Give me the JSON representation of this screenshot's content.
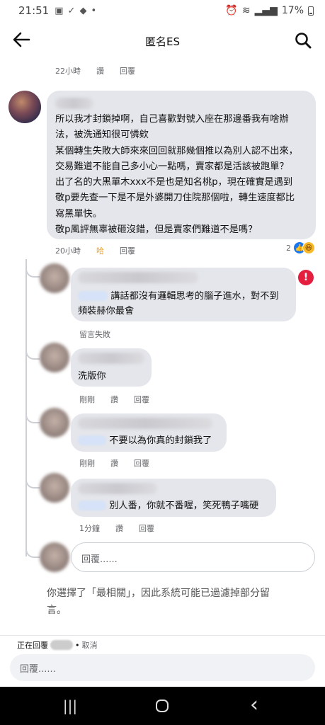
{
  "status_bar": {
    "time": "21:51",
    "dot": "•",
    "battery_percent": "17%"
  },
  "header": {
    "title": "匿名ES"
  },
  "top_meta": {
    "time": "22小時",
    "like": "讚",
    "reply": "回覆"
  },
  "main_comment": {
    "text": "所以我才封鎖掉啊，自己喜歡對號入座在那邊番我有啥辦\n法，被洗通知很可憐欸\n某個轉生失敗大師來來回回就那幾個推以為別人認不出來，\n交易難道不能自己多小心一點嗎，賣家都是活該被跑單？\n出了名的大黑單木xxx不是也是知名桃p，現在確實是遇到\n敬p要先查一下是不是外婆開刀住院那個啦，轉生速度都比\n寫黑單快。\n敬p風評無辜被砸沒錯，但是賣家們難道不是嗎？",
    "time": "20小時",
    "like": "哈",
    "reply": "回覆",
    "reaction_count": "2",
    "reaction_like": "👍",
    "reaction_haha": "😆"
  },
  "replies": [
    {
      "text_line1": "講話都沒有邏輯思考的腦子進水，對不到",
      "text_line2": "頻裝赫你最會",
      "status": "留言失敗",
      "error_mark": "!"
    },
    {
      "text": "洗版你",
      "time": "剛剛",
      "like": "讚",
      "reply": "回覆"
    },
    {
      "text": "不要以為你真的封鎖我了",
      "time": "剛剛",
      "like": "讚",
      "reply": "回覆"
    },
    {
      "text": "別人番，你就不番喔，笑死鴨子嘴硬",
      "time": "1分鐘",
      "like": "讚",
      "reply": "回覆"
    }
  ],
  "reply_box": {
    "placeholder": "回覆......"
  },
  "filter_note": "你選擇了「最相關」，因此系統可能已過濾掉部分留言。",
  "replying_bar": {
    "prefix": "正在回覆",
    "separator": "•",
    "cancel": "取消"
  },
  "bottom_input": {
    "placeholder": "回覆......"
  },
  "nav": {
    "recents": "|||",
    "back": "‹"
  },
  "colors": {
    "bubble": "#e4e6eb",
    "meta": "#65676b",
    "like_blue": "#1877f2",
    "haha_yellow": "#f7b928",
    "error_red": "#e41e3f",
    "haha_text": "#f0a020"
  }
}
